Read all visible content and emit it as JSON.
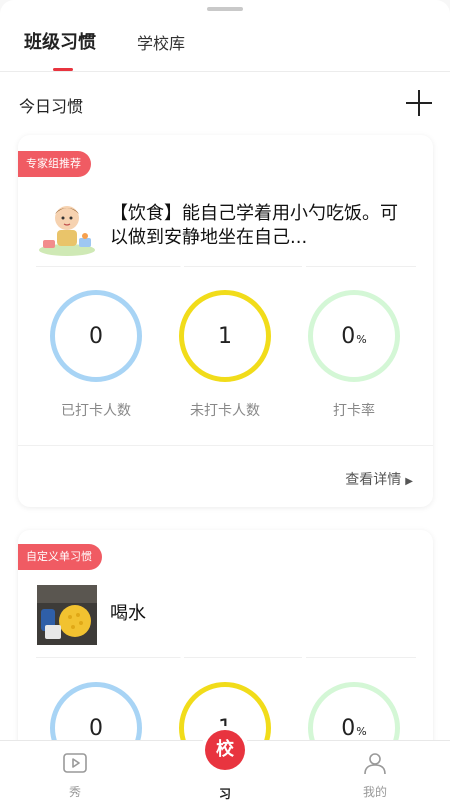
{
  "tabs": [
    {
      "label": "班级习惯",
      "active": true
    },
    {
      "label": "学校库",
      "active": false
    }
  ],
  "section": {
    "title": "今日习惯"
  },
  "cards": [
    {
      "badge": "专家组推荐",
      "title": "【饮食】能自己学着用小勺吃饭。可以做到安静地坐在自己...",
      "stats": [
        {
          "value": "0",
          "unit": "",
          "label": "已打卡人数",
          "ring_color": "#a8d4f5"
        },
        {
          "value": "1",
          "unit": "",
          "label": "未打卡人数",
          "ring_color": "#f1dc1a"
        },
        {
          "value": "0",
          "unit": "%",
          "label": "打卡率",
          "ring_color": "#d4f7d6"
        }
      ],
      "details": "查看详情"
    },
    {
      "badge": "自定义单习惯",
      "title": "喝水",
      "stats": [
        {
          "value": "0",
          "unit": "",
          "label": "",
          "ring_color": "#a8d4f5"
        },
        {
          "value": "1",
          "unit": "",
          "label": "",
          "ring_color": "#f1dc1a"
        },
        {
          "value": "0",
          "unit": "%",
          "label": "",
          "ring_color": "#d4f7d6"
        }
      ]
    }
  ],
  "bottom_nav": [
    {
      "label": "秀",
      "icon": "play-video-icon"
    },
    {
      "label": "习",
      "icon": "school-badge-icon",
      "fab": "校"
    },
    {
      "label": "我的",
      "icon": "person-icon"
    }
  ],
  "colors": {
    "accent": "#e8343f",
    "badge": "#f05b63"
  }
}
